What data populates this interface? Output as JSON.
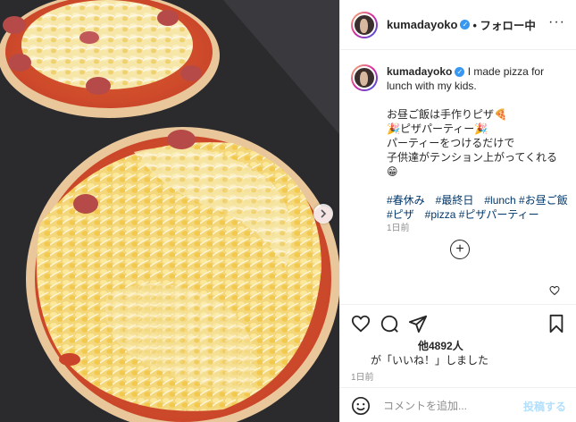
{
  "post": {
    "username": "kumadayoko",
    "follow_label": "• フォロー中",
    "caption_lines": [
      "I made pizza for lunch with my kids.",
      "お昼ご飯は手作りピザ🍕",
      "🎉ピザパーティー🎉",
      "パーティーをつけるだけで",
      "子供達がテンション上がってくれる",
      "😁"
    ],
    "hashtags_line1": "#春休み　#最終日　#lunch #お昼ご飯",
    "hashtags_line2": "#ピザ　#pizza #ピザパーティー",
    "caption_time": "1日前",
    "likes_count": "他4892人",
    "liked_by_text": "が「いいね！」しました",
    "post_time": "1日前",
    "comment_placeholder": "コメントを追加...",
    "post_button": "投稿する"
  },
  "icons": [
    "heart-icon",
    "comment-icon",
    "share-icon",
    "bookmark-icon",
    "emoji-icon",
    "plus-icon",
    "next-arrow-icon",
    "more-icon"
  ],
  "colors": {
    "link": "#00376b",
    "verified": "#3897f0",
    "post_button": "#b2dffc",
    "muted": "#8e8e8e"
  }
}
